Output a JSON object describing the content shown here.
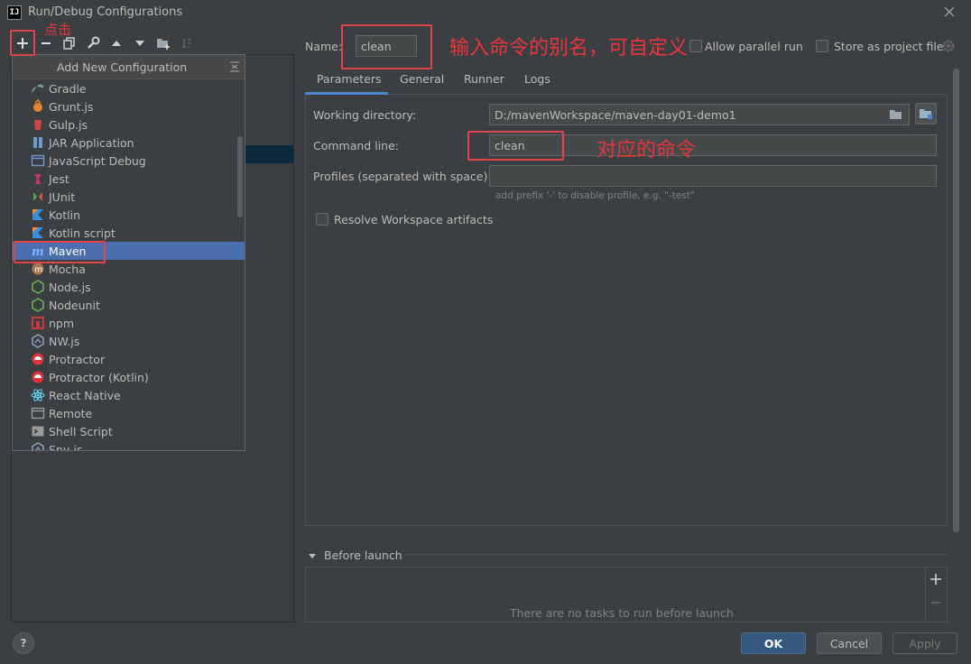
{
  "window": {
    "title": "Run/Debug Configurations",
    "logo_text": "IJ"
  },
  "popup": {
    "title": "Add New Configuration",
    "items": [
      {
        "label": "Gradle",
        "icon": "gradle-icon",
        "color": "#7aa0a3"
      },
      {
        "label": "Grunt.js",
        "icon": "grunt-icon",
        "color": "#e48632"
      },
      {
        "label": "Gulp.js",
        "icon": "gulp-icon",
        "color": "#cf4646"
      },
      {
        "label": "JAR Application",
        "icon": "jar-icon",
        "color": "#6a9ccf"
      },
      {
        "label": "JavaScript Debug",
        "icon": "js-debug-icon",
        "color": "#6a9ccf"
      },
      {
        "label": "Jest",
        "icon": "jest-icon",
        "color": "#c2386b"
      },
      {
        "label": "JUnit",
        "icon": "junit-icon",
        "color": "#e05a3a"
      },
      {
        "label": "Kotlin",
        "icon": "kotlin-icon",
        "color": "#3a8fe0"
      },
      {
        "label": "Kotlin script",
        "icon": "kotlin-script-icon",
        "color": "#3a8fe0"
      },
      {
        "label": "Maven",
        "icon": "maven-icon",
        "color": "#7cb7ff"
      },
      {
        "label": "Mocha",
        "icon": "mocha-icon",
        "color": "#a7774f"
      },
      {
        "label": "Node.js",
        "icon": "nodejs-icon",
        "color": "#6aa84f"
      },
      {
        "label": "Nodeunit",
        "icon": "nodeunit-icon",
        "color": "#6aa84f"
      },
      {
        "label": "npm",
        "icon": "npm-icon",
        "color": "#cb3837"
      },
      {
        "label": "NW.js",
        "icon": "nwjs-icon",
        "color": "#8fa9c8"
      },
      {
        "label": "Protractor",
        "icon": "protractor-icon",
        "color": "#e23237"
      },
      {
        "label": "Protractor (Kotlin)",
        "icon": "protractor-kotlin-icon",
        "color": "#e23237"
      },
      {
        "label": "React Native",
        "icon": "react-native-icon",
        "color": "#61dafb"
      },
      {
        "label": "Remote",
        "icon": "remote-icon",
        "color": "#9a9a9a"
      },
      {
        "label": "Shell Script",
        "icon": "shell-script-icon",
        "color": "#9a9a9a"
      },
      {
        "label": "Spy-js",
        "icon": "spyjs-icon",
        "color": "#8fa9c8"
      }
    ],
    "selected_label": "Maven"
  },
  "config": {
    "name_label": "Name:",
    "name_value": "clean",
    "allow_parallel_label": "Allow parallel run",
    "store_project_label": "Store as project file",
    "tabs": [
      "Parameters",
      "General",
      "Runner",
      "Logs"
    ],
    "working_dir_label": "Working directory:",
    "working_dir_value": "D:/mavenWorkspace/maven-day01-demo1",
    "command_line_label": "Command line:",
    "command_line_value": "clean",
    "profiles_label": "Profiles (separated with space):",
    "profiles_value": "",
    "profiles_hint": "add prefix '-' to disable profile, e.g. \"-test\"",
    "resolve_label": "Resolve Workspace artifacts",
    "before_launch_label": "Before launch",
    "no_tasks_text": "There are no tasks to run before launch"
  },
  "buttons": {
    "ok": "OK",
    "cancel": "Cancel",
    "apply": "Apply",
    "help": "?"
  },
  "annotations": {
    "click": "点击",
    "name_alias": "输入命令的别名，可自定义",
    "command": "对应的命令"
  },
  "colors": {
    "accent_red": "#e0434a",
    "selection": "#4b6eaf",
    "ok_blue": "#365880"
  }
}
